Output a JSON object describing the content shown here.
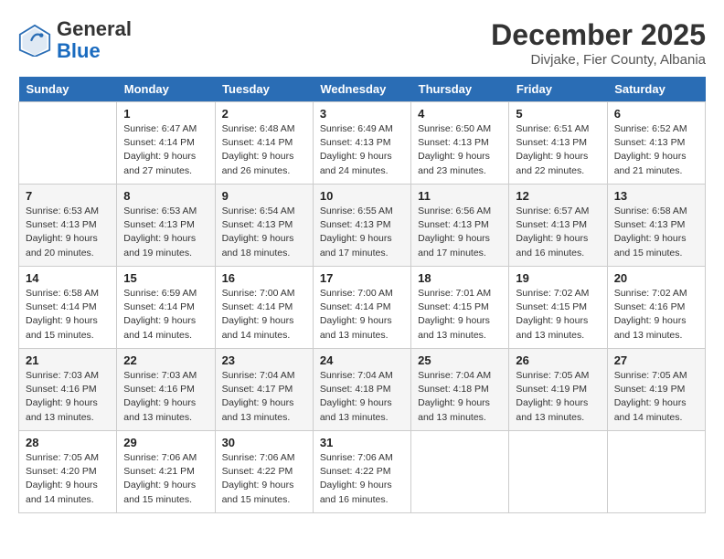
{
  "header": {
    "logo_general": "General",
    "logo_blue": "Blue",
    "month": "December 2025",
    "location": "Divjake, Fier County, Albania"
  },
  "calendar": {
    "days_of_week": [
      "Sunday",
      "Monday",
      "Tuesday",
      "Wednesday",
      "Thursday",
      "Friday",
      "Saturday"
    ],
    "weeks": [
      [
        {
          "day": "",
          "info": ""
        },
        {
          "day": "1",
          "info": "Sunrise: 6:47 AM\nSunset: 4:14 PM\nDaylight: 9 hours\nand 27 minutes."
        },
        {
          "day": "2",
          "info": "Sunrise: 6:48 AM\nSunset: 4:14 PM\nDaylight: 9 hours\nand 26 minutes."
        },
        {
          "day": "3",
          "info": "Sunrise: 6:49 AM\nSunset: 4:13 PM\nDaylight: 9 hours\nand 24 minutes."
        },
        {
          "day": "4",
          "info": "Sunrise: 6:50 AM\nSunset: 4:13 PM\nDaylight: 9 hours\nand 23 minutes."
        },
        {
          "day": "5",
          "info": "Sunrise: 6:51 AM\nSunset: 4:13 PM\nDaylight: 9 hours\nand 22 minutes."
        },
        {
          "day": "6",
          "info": "Sunrise: 6:52 AM\nSunset: 4:13 PM\nDaylight: 9 hours\nand 21 minutes."
        }
      ],
      [
        {
          "day": "7",
          "info": "Sunrise: 6:53 AM\nSunset: 4:13 PM\nDaylight: 9 hours\nand 20 minutes."
        },
        {
          "day": "8",
          "info": "Sunrise: 6:53 AM\nSunset: 4:13 PM\nDaylight: 9 hours\nand 19 minutes."
        },
        {
          "day": "9",
          "info": "Sunrise: 6:54 AM\nSunset: 4:13 PM\nDaylight: 9 hours\nand 18 minutes."
        },
        {
          "day": "10",
          "info": "Sunrise: 6:55 AM\nSunset: 4:13 PM\nDaylight: 9 hours\nand 17 minutes."
        },
        {
          "day": "11",
          "info": "Sunrise: 6:56 AM\nSunset: 4:13 PM\nDaylight: 9 hours\nand 17 minutes."
        },
        {
          "day": "12",
          "info": "Sunrise: 6:57 AM\nSunset: 4:13 PM\nDaylight: 9 hours\nand 16 minutes."
        },
        {
          "day": "13",
          "info": "Sunrise: 6:58 AM\nSunset: 4:13 PM\nDaylight: 9 hours\nand 15 minutes."
        }
      ],
      [
        {
          "day": "14",
          "info": "Sunrise: 6:58 AM\nSunset: 4:14 PM\nDaylight: 9 hours\nand 15 minutes."
        },
        {
          "day": "15",
          "info": "Sunrise: 6:59 AM\nSunset: 4:14 PM\nDaylight: 9 hours\nand 14 minutes."
        },
        {
          "day": "16",
          "info": "Sunrise: 7:00 AM\nSunset: 4:14 PM\nDaylight: 9 hours\nand 14 minutes."
        },
        {
          "day": "17",
          "info": "Sunrise: 7:00 AM\nSunset: 4:14 PM\nDaylight: 9 hours\nand 13 minutes."
        },
        {
          "day": "18",
          "info": "Sunrise: 7:01 AM\nSunset: 4:15 PM\nDaylight: 9 hours\nand 13 minutes."
        },
        {
          "day": "19",
          "info": "Sunrise: 7:02 AM\nSunset: 4:15 PM\nDaylight: 9 hours\nand 13 minutes."
        },
        {
          "day": "20",
          "info": "Sunrise: 7:02 AM\nSunset: 4:16 PM\nDaylight: 9 hours\nand 13 minutes."
        }
      ],
      [
        {
          "day": "21",
          "info": "Sunrise: 7:03 AM\nSunset: 4:16 PM\nDaylight: 9 hours\nand 13 minutes."
        },
        {
          "day": "22",
          "info": "Sunrise: 7:03 AM\nSunset: 4:16 PM\nDaylight: 9 hours\nand 13 minutes."
        },
        {
          "day": "23",
          "info": "Sunrise: 7:04 AM\nSunset: 4:17 PM\nDaylight: 9 hours\nand 13 minutes."
        },
        {
          "day": "24",
          "info": "Sunrise: 7:04 AM\nSunset: 4:18 PM\nDaylight: 9 hours\nand 13 minutes."
        },
        {
          "day": "25",
          "info": "Sunrise: 7:04 AM\nSunset: 4:18 PM\nDaylight: 9 hours\nand 13 minutes."
        },
        {
          "day": "26",
          "info": "Sunrise: 7:05 AM\nSunset: 4:19 PM\nDaylight: 9 hours\nand 13 minutes."
        },
        {
          "day": "27",
          "info": "Sunrise: 7:05 AM\nSunset: 4:19 PM\nDaylight: 9 hours\nand 14 minutes."
        }
      ],
      [
        {
          "day": "28",
          "info": "Sunrise: 7:05 AM\nSunset: 4:20 PM\nDaylight: 9 hours\nand 14 minutes."
        },
        {
          "day": "29",
          "info": "Sunrise: 7:06 AM\nSunset: 4:21 PM\nDaylight: 9 hours\nand 15 minutes."
        },
        {
          "day": "30",
          "info": "Sunrise: 7:06 AM\nSunset: 4:22 PM\nDaylight: 9 hours\nand 15 minutes."
        },
        {
          "day": "31",
          "info": "Sunrise: 7:06 AM\nSunset: 4:22 PM\nDaylight: 9 hours\nand 16 minutes."
        },
        {
          "day": "",
          "info": ""
        },
        {
          "day": "",
          "info": ""
        },
        {
          "day": "",
          "info": ""
        }
      ]
    ]
  }
}
